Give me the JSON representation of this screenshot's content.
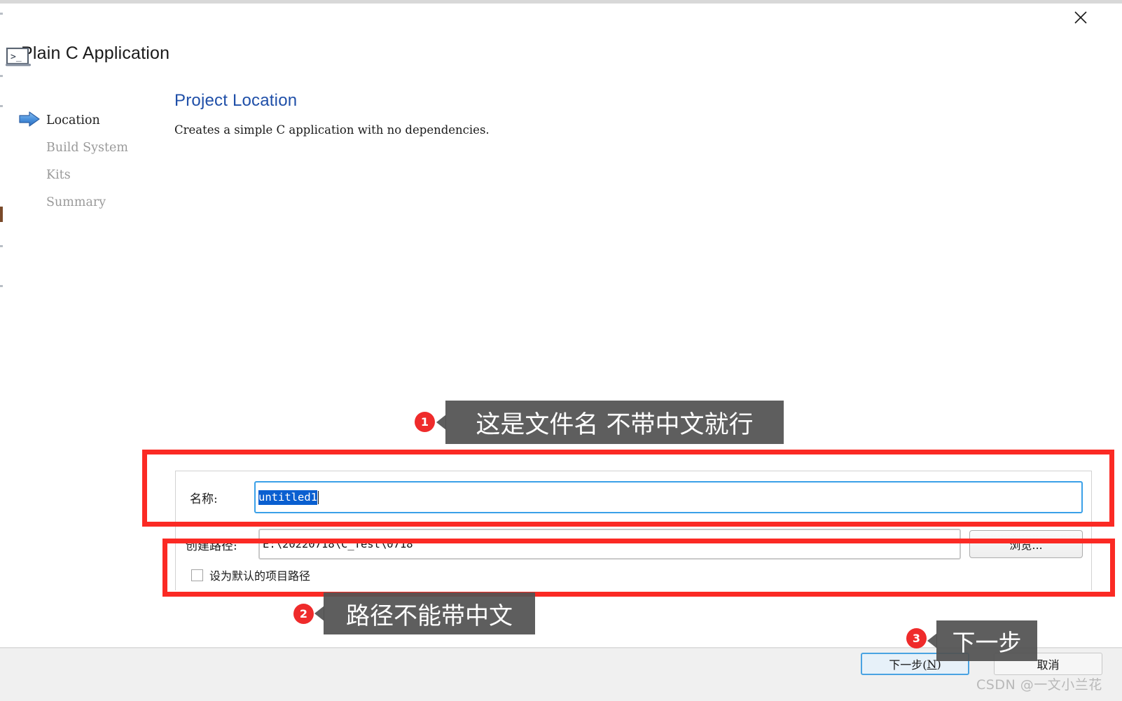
{
  "window": {
    "title": "Plain C Application",
    "close_icon": "close-icon",
    "app_icon": "terminal-icon"
  },
  "sidebar": {
    "items": [
      {
        "label": "Location",
        "active": true,
        "icon": "blue-arrow-icon"
      },
      {
        "label": "Build System",
        "active": false
      },
      {
        "label": "Kits",
        "active": false
      },
      {
        "label": "Summary",
        "active": false
      }
    ]
  },
  "main": {
    "page_title": "Project Location",
    "page_description": "Creates a simple C application with no dependencies.",
    "fields": {
      "name_label": "名称:",
      "name_value": "untitled1",
      "path_label": "创建路径:",
      "path_value": "E:\\20220718\\C_Test\\0718",
      "browse_label": "浏览..."
    },
    "checkbox": {
      "label": "设为默认的项目路径",
      "checked": false
    }
  },
  "footer": {
    "next_label_prefix": "下一步(",
    "next_mnemonic": "N",
    "next_label_suffix": ")",
    "cancel_label": "取消"
  },
  "annotations": {
    "callouts": [
      {
        "number": "1",
        "text": "这是文件名 不带中文就行"
      },
      {
        "number": "2",
        "text": "路径不能带中文"
      },
      {
        "number": "3",
        "text": "下一步"
      }
    ],
    "highlight_color": "#fb2a24",
    "badge_color": "#ef2b2b",
    "bubble_color": "#525252"
  },
  "watermark": "CSDN @一文小兰花",
  "colors": {
    "page_title": "#1f4fa8",
    "selection": "#0a5fd0",
    "focus_border": "#3aa0e8",
    "footer_bg": "#f0f0f0"
  }
}
